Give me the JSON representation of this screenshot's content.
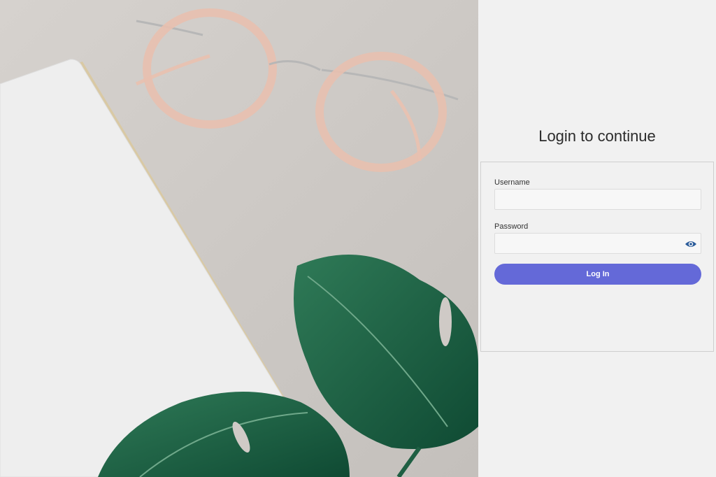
{
  "login": {
    "title": "Login to continue",
    "username": {
      "label": "Username",
      "value": "",
      "placeholder": ""
    },
    "password": {
      "label": "Password",
      "value": "",
      "placeholder": ""
    },
    "submit_label": "Log In",
    "password_toggle_icon": "eye-icon"
  },
  "colors": {
    "accent": "#6469d8",
    "panel_background": "#f1f1f1",
    "eye_icon": "#2a5b9a"
  },
  "photo": {
    "subject": "decorative-background-image"
  }
}
